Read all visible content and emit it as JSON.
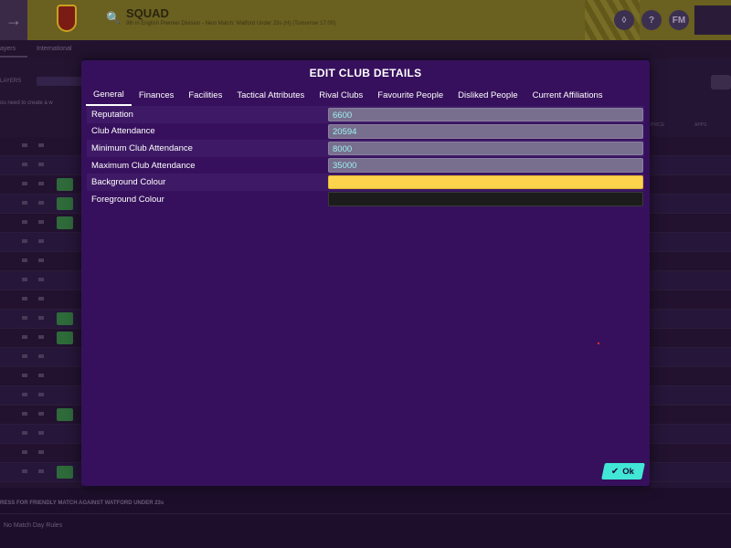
{
  "app": {
    "title": "SQUAD",
    "subtitle": "9th in English Premier Division - Next Match: Watford Under 23s (H) (Tomorrow 17:00)",
    "subnav": [
      "ayers",
      "International"
    ],
    "sidebar_label": "LAYERS",
    "sidebar_note": "ou need to create a w",
    "footer_title": "RESS FOR FRIENDLY MATCH AGAINST WATFORD UNDER 23s",
    "footer_text": "No Match Day Rules",
    "right_labels": [
      "PRICE",
      "APPS"
    ],
    "hdr_icons": [
      "shield-icon",
      "help-icon",
      "FM"
    ]
  },
  "dialog": {
    "title": "EDIT CLUB DETAILS",
    "tabs": [
      {
        "label": "General",
        "active": true
      },
      {
        "label": "Finances"
      },
      {
        "label": "Facilities"
      },
      {
        "label": "Tactical Attributes"
      },
      {
        "label": "Rival Clubs"
      },
      {
        "label": "Favourite People"
      },
      {
        "label": "Disliked People"
      },
      {
        "label": "Current Affiliations"
      }
    ],
    "fields": {
      "reputation": {
        "label": "Reputation",
        "value": "6600"
      },
      "club_attendance": {
        "label": "Club Attendance",
        "value": "20594"
      },
      "min_attendance": {
        "label": "Minimum Club Attendance",
        "value": "8000"
      },
      "max_attendance": {
        "label": "Maximum Club Attendance",
        "value": "35000"
      },
      "background_colour": {
        "label": "Background Colour",
        "color": "#fcd34d"
      },
      "foreground_colour": {
        "label": "Foreground Colour",
        "color": "#1c1c1c"
      }
    },
    "ok_label": "Ok"
  },
  "colors": {
    "modal_bg": "#36105c",
    "accent": "#41e6d6",
    "field_text": "#9cf2f2"
  }
}
